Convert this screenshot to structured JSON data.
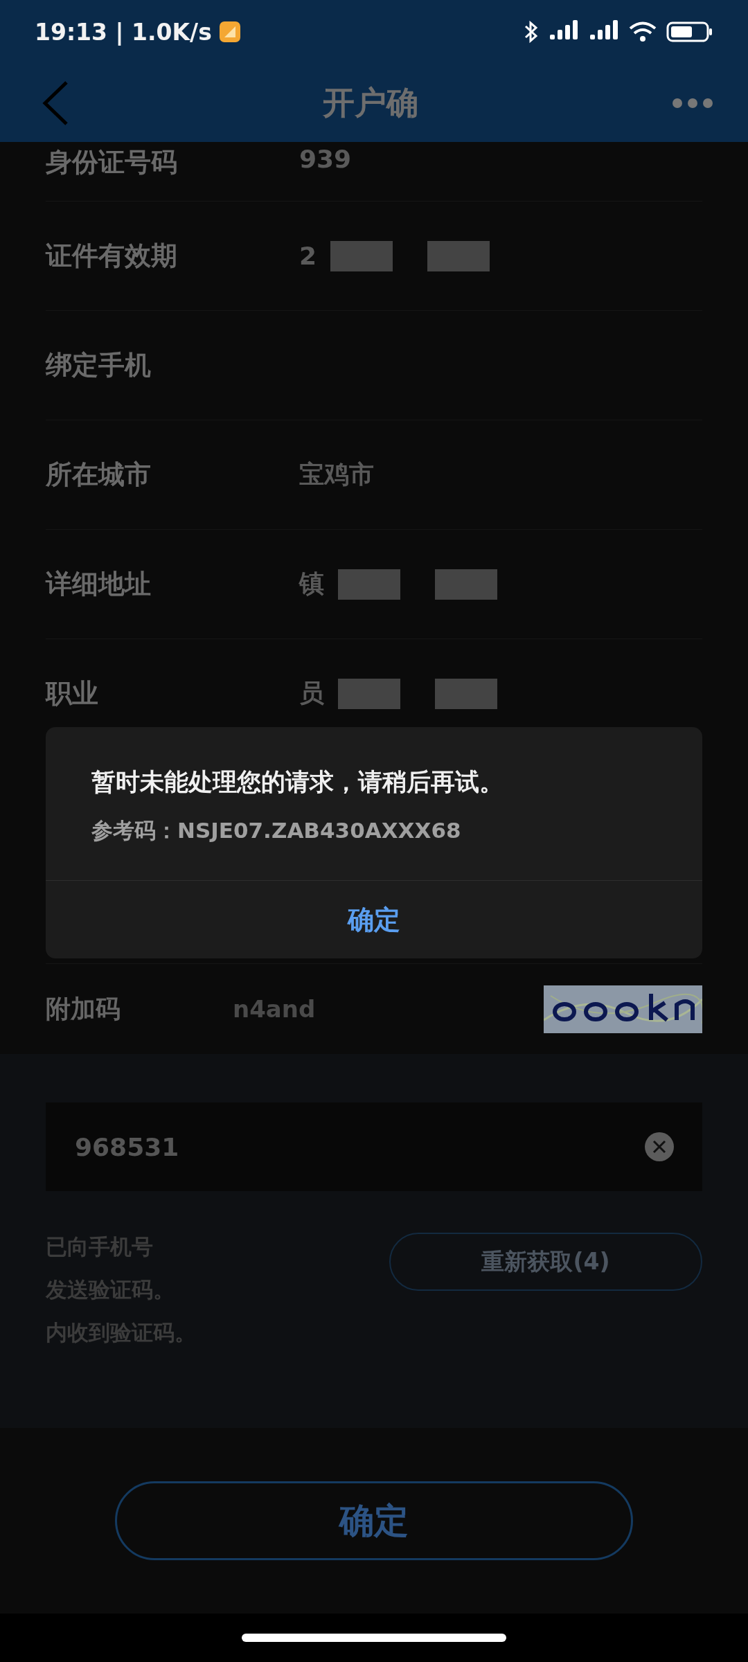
{
  "status_bar": {
    "time": "19:13 | 1.0K/s"
  },
  "header": {
    "title": "开户确"
  },
  "fields": [
    {
      "label": "身份证号码",
      "value": "939",
      "redacted": false
    },
    {
      "label": "证件有效期",
      "value": "2",
      "redacted": true
    },
    {
      "label": "绑定手机",
      "redacted": false
    },
    {
      "label": "所在城市",
      "value": "宝鸡市",
      "redacted": false
    },
    {
      "label": "详细地址",
      "value": "镇",
      "redacted": true
    },
    {
      "label": "职业",
      "value": "员",
      "redacted": true
    }
  ],
  "dialog": {
    "message": "暂时未能处理您的请求，请稍后再试。",
    "reference": "参考码：NSJE07.ZAB430AXXX68",
    "button": "确定"
  },
  "extra_code": {
    "label": "附加码",
    "value": "n4and"
  },
  "sms": {
    "value": "968531",
    "hint_lines": [
      "已向手机号",
      "发送验证码。",
      "内收到验证码。"
    ],
    "resend": "重新获取(4)"
  },
  "submit": "确定"
}
